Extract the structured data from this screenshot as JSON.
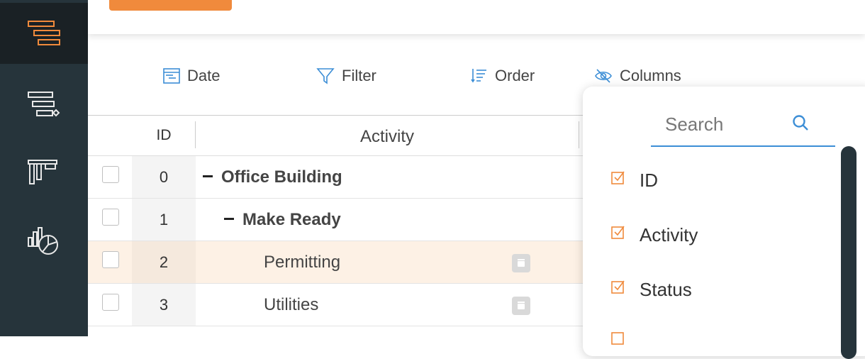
{
  "header": {
    "primary_button_label": "",
    "tab_label": ""
  },
  "toolbar": {
    "date_label": "Date",
    "filter_label": "Filter",
    "order_label": "Order",
    "columns_label": "Columns"
  },
  "table": {
    "headers": {
      "id": "ID",
      "activity": "Activity"
    },
    "rows": [
      {
        "id": "0",
        "activity": "Office Building",
        "level": 0,
        "bold": true,
        "collapsible": true,
        "highlighted": false,
        "calendar": false
      },
      {
        "id": "1",
        "activity": "Make Ready",
        "level": 1,
        "bold": true,
        "collapsible": true,
        "highlighted": false,
        "calendar": false
      },
      {
        "id": "2",
        "activity": "Permitting",
        "level": 2,
        "bold": false,
        "collapsible": false,
        "highlighted": true,
        "calendar": true
      },
      {
        "id": "3",
        "activity": "Utilities",
        "level": 2,
        "bold": false,
        "collapsible": false,
        "highlighted": false,
        "calendar": true
      }
    ]
  },
  "columns_panel": {
    "search_placeholder": "Search",
    "options": [
      {
        "label": "ID",
        "checked": true
      },
      {
        "label": "Activity",
        "checked": true
      },
      {
        "label": "Status",
        "checked": true
      }
    ]
  },
  "sidebar": {
    "items": [
      {
        "icon": "gantt-icon",
        "active": true
      },
      {
        "icon": "gantt-diamond-icon",
        "active": false
      },
      {
        "icon": "board-icon",
        "active": false
      },
      {
        "icon": "chart-icon",
        "active": false
      }
    ]
  },
  "colors": {
    "accent": "#f08a3c",
    "sidebar": "#26343b",
    "link_blue": "#3c8ed6"
  }
}
